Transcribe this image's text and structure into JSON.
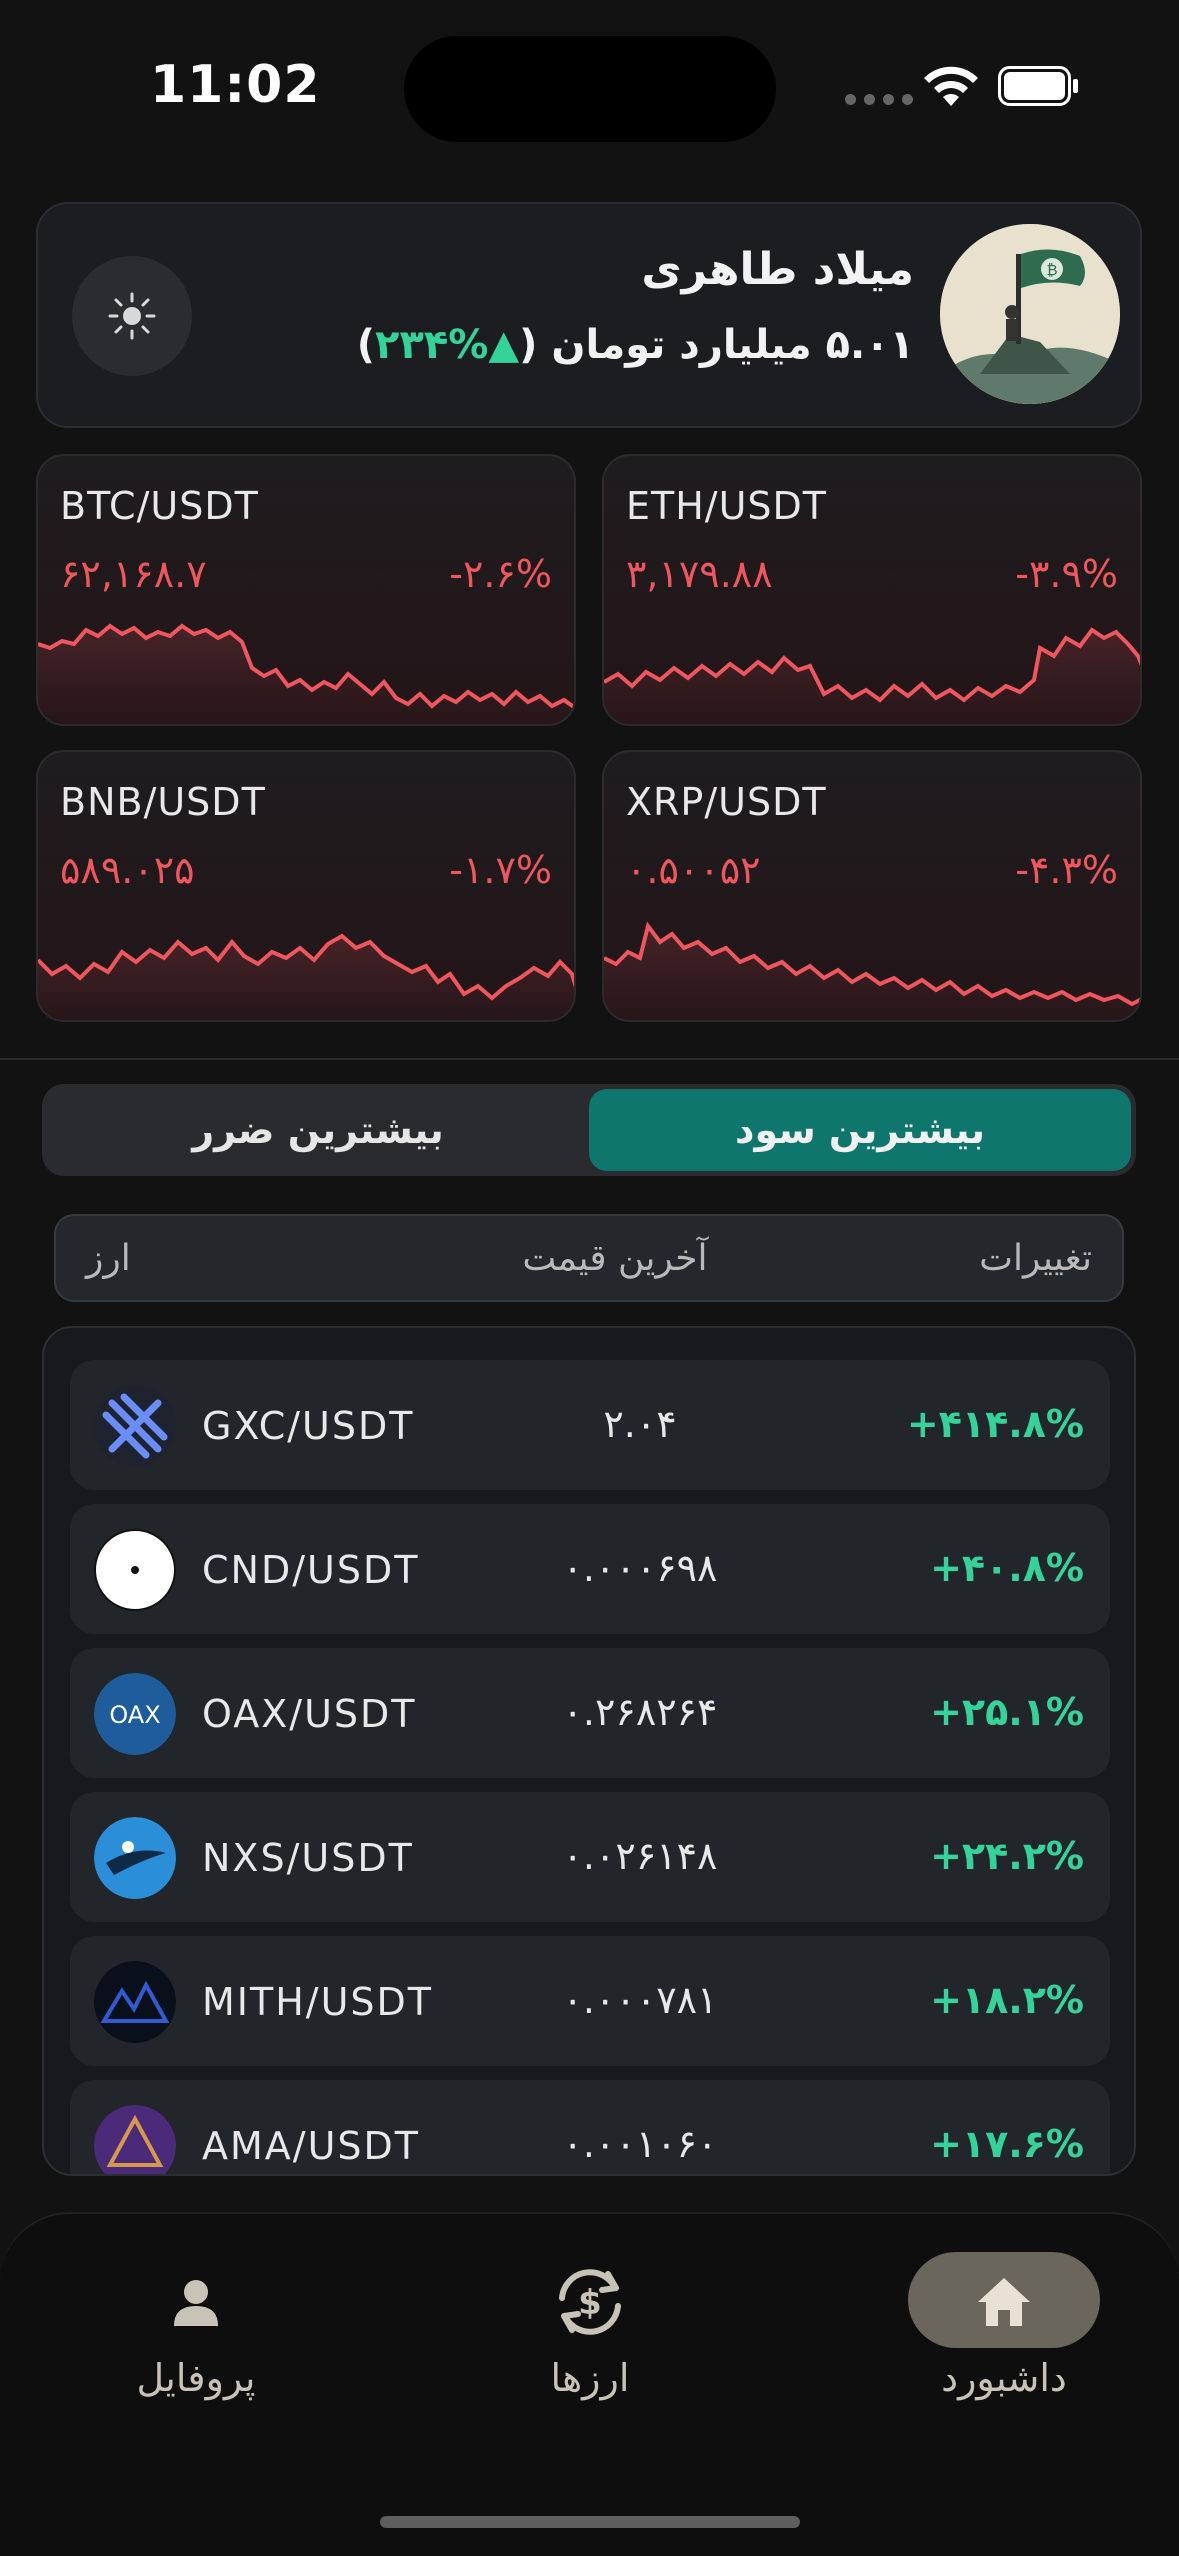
{
  "status_bar": {
    "time": "11:02"
  },
  "user": {
    "name": "میلاد طاهری",
    "balance": "۵.۰۱ میلیارد تومان",
    "gain_open": "(",
    "gain": "▲%۲۳۴",
    "gain_close": ")"
  },
  "markets": [
    {
      "pair": "BTC/USDT",
      "price": "۶۲,۱۶۸.۷",
      "change": "-۲.۶%"
    },
    {
      "pair": "ETH/USDT",
      "price": "۳,۱۷۹.۸۸",
      "change": "-۳.۹%"
    },
    {
      "pair": "BNB/USDT",
      "price": "۵۸۹.۰۲۵",
      "change": "-۱.۷%"
    },
    {
      "pair": "XRP/USDT",
      "price": "۰.۵۰۰۵۲",
      "change": "-۴.۳%"
    }
  ],
  "tabs": {
    "gainers": "بیشترین سود",
    "losers": "بیشترین ضرر"
  },
  "columns": {
    "changes": "تغییرات",
    "last_price": "آخرین قیمت",
    "currency": "ارز"
  },
  "rows": [
    {
      "symbol": "GXC/USDT",
      "price": "۲.۰۴",
      "change": "+۴۱۴.۸%",
      "icon": "gxc-icon"
    },
    {
      "symbol": "CND/USDT",
      "price": "۰.۰۰۰۶۹۸",
      "change": "+۴۰.۸%",
      "icon": "cnd-icon"
    },
    {
      "symbol": "OAX/USDT",
      "price": "۰.۲۶۸۲۶۴",
      "change": "+۲۵.۱%",
      "icon": "oax-icon"
    },
    {
      "symbol": "NXS/USDT",
      "price": "۰.۰۲۶۱۴۸",
      "change": "+۲۴.۲%",
      "icon": "nxs-icon"
    },
    {
      "symbol": "MITH/USDT",
      "price": "۰.۰۰۰۷۸۱",
      "change": "+۱۸.۲%",
      "icon": "mith-icon"
    },
    {
      "symbol": "AMA/USDT",
      "price": "۰.۰۰۱۰۶۰",
      "change": "+۱۷.۶%",
      "icon": "ama-icon"
    }
  ],
  "oax_logo_text": "OAX",
  "nav": {
    "dashboard": "داشبورد",
    "currencies": "ارزها",
    "profile": "پروفایل"
  },
  "colors": {
    "accent": "#0F766E",
    "negative": "#F0565E",
    "positive": "#34D399"
  }
}
